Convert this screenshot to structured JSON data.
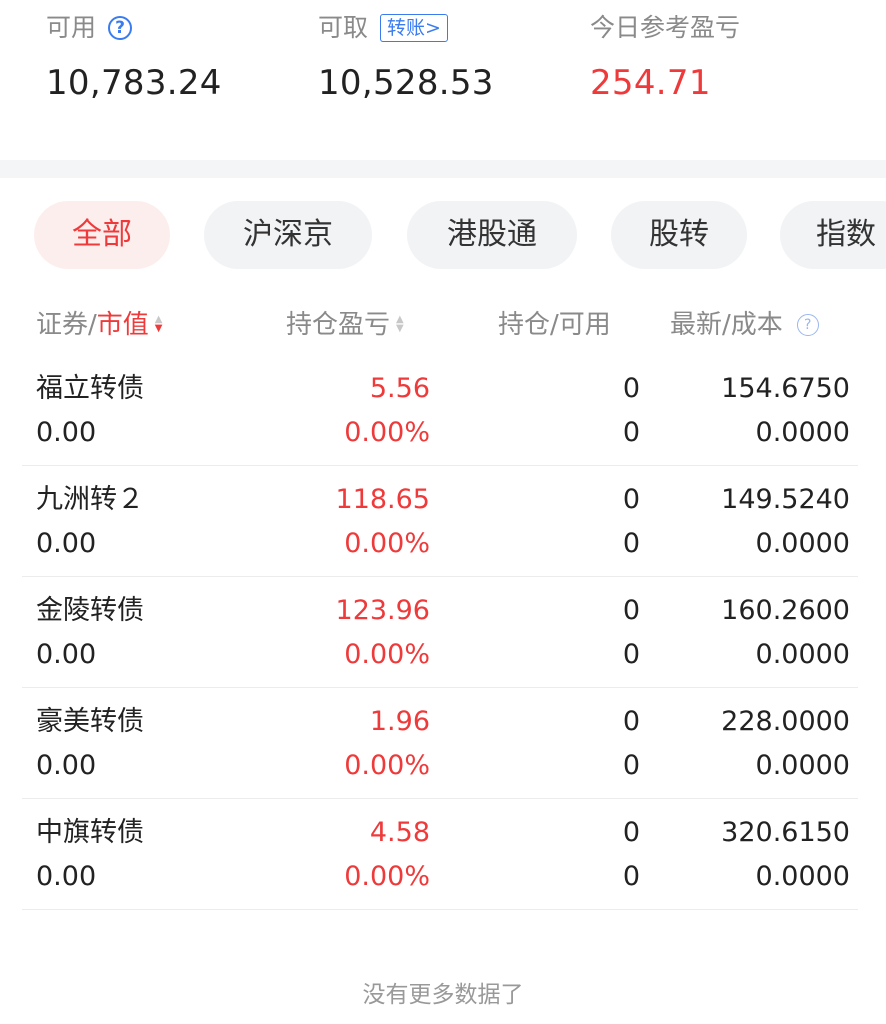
{
  "summary": {
    "available": {
      "label": "可用",
      "value": "10,783.24"
    },
    "withdrawable": {
      "label": "可取",
      "value": "10,528.53",
      "transfer_label": "转账>"
    },
    "today_pl": {
      "label": "今日参考盈亏",
      "value": "254.71"
    }
  },
  "tabs": [
    "全部",
    "沪深京",
    "港股通",
    "股转",
    "指数"
  ],
  "table": {
    "headers": {
      "security": "证券/",
      "market_value": "市值",
      "position_pl": "持仓盈亏",
      "position_available": "持仓/可用",
      "latest_cost": "最新/成本"
    },
    "rows": [
      {
        "name": "福立转债",
        "market_value": "0.00",
        "pl": "5.56",
        "pl_pct": "0.00%",
        "hold": "0",
        "avail": "0",
        "latest": "154.6750",
        "cost": "0.0000"
      },
      {
        "name": "九洲转２",
        "market_value": "0.00",
        "pl": "118.65",
        "pl_pct": "0.00%",
        "hold": "0",
        "avail": "0",
        "latest": "149.5240",
        "cost": "0.0000"
      },
      {
        "name": "金陵转债",
        "market_value": "0.00",
        "pl": "123.96",
        "pl_pct": "0.00%",
        "hold": "0",
        "avail": "0",
        "latest": "160.2600",
        "cost": "0.0000"
      },
      {
        "name": "豪美转债",
        "market_value": "0.00",
        "pl": "1.96",
        "pl_pct": "0.00%",
        "hold": "0",
        "avail": "0",
        "latest": "228.0000",
        "cost": "0.0000"
      },
      {
        "name": "中旗转债",
        "market_value": "0.00",
        "pl": "4.58",
        "pl_pct": "0.00%",
        "hold": "0",
        "avail": "0",
        "latest": "320.6150",
        "cost": "0.0000"
      }
    ]
  },
  "footer": "没有更多数据了",
  "colors": {
    "accent_red": "#ee3a3a",
    "accent_blue": "#3a7cf0"
  }
}
